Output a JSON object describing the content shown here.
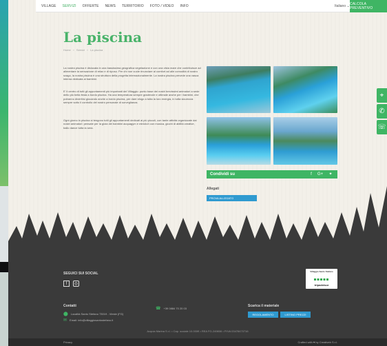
{
  "nav": {
    "items": [
      "VILLAGE",
      "SERVIZI",
      "OFFERTE",
      "NEWS",
      "TERRITORIO",
      "FOTO / VIDEO",
      "INFO"
    ],
    "language": "Italiano",
    "cta": "CALCOLA PREVENTIVO"
  },
  "page": {
    "title": "La piscina",
    "breadcrumb": [
      "Home",
      "Servizi",
      "La piscina"
    ]
  },
  "content": {
    "p1": "La nostra piscina è dislocata in una bassissima geografica vegetazione e con una vista mare che contribuisce ad alimentare la sensazione di relax e di riposo. Per chi non vuole rinunciare al comfort ad alle comodità di nostro svago, la nostra piscina è una struttura della progetta internazionalmente. La nostra piscina prevede una vasca interna dedicata ai bambini.",
    "p2": "E' il centro di tutti gli appuntamenti più importanti del Villaggio: punto base dei nostri brevissimi animatori a sede dello più bella festa a bordo piscina. Ha una temperatura sempre gradevole e ottimale anche per i bambini, che potranno divertirsi giocando anche a bordo piscina, per dare sfogo a tutta la loro energia, in tutta sicurezza sempre sotto il controllo del nostro personale di sorveglianza.",
    "p3": "Ogni giorno in piscina si tengono tutti gli appuntamenti dedicati ai più piccoli, con tante attività organizzate dai nostri animatori: pensate per la gioia dei bambini acquagym e minicluh con musica, giochi di abilità creative, ballo dance tutta la sera."
  },
  "share": {
    "label": "Condividi su",
    "icons": [
      "facebook-icon",
      "google-plus-icon",
      "twitter-icon"
    ]
  },
  "attachments": {
    "title": "Allegati",
    "button": "PROVA ALLEGATO"
  },
  "footer": {
    "social_title": "SEGUICI SUI SOCIAL",
    "tripadvisor": {
      "line1": "Villaggio Santo Stefano",
      "brand": "tripadvisor"
    },
    "contacts_title": "Contatti",
    "address": "Località Santo Stefano 73019 - Vieste (FG)",
    "phone": "+39 0884 70 20 03",
    "email": "Email: info@villaggiosantostefano.it",
    "material_title": "Scarica il materiale",
    "btn_regolamento": "REGOLAMENTO",
    "btn_listino": "LISTINO PREZZI",
    "legal": "Acquia Marina S.r.l.  •  Cap. sociale 10.000€  •  REA FG-249806  •  P.IVA 03478470716",
    "privacy": "Privacy",
    "credits": "Crafted with ♥ by Creativeb S.r.l."
  },
  "colors": {
    "green": "#3fb564",
    "title_green": "#49b36a",
    "blue": "#2f9ad0",
    "footer": "#3a3a3a"
  }
}
